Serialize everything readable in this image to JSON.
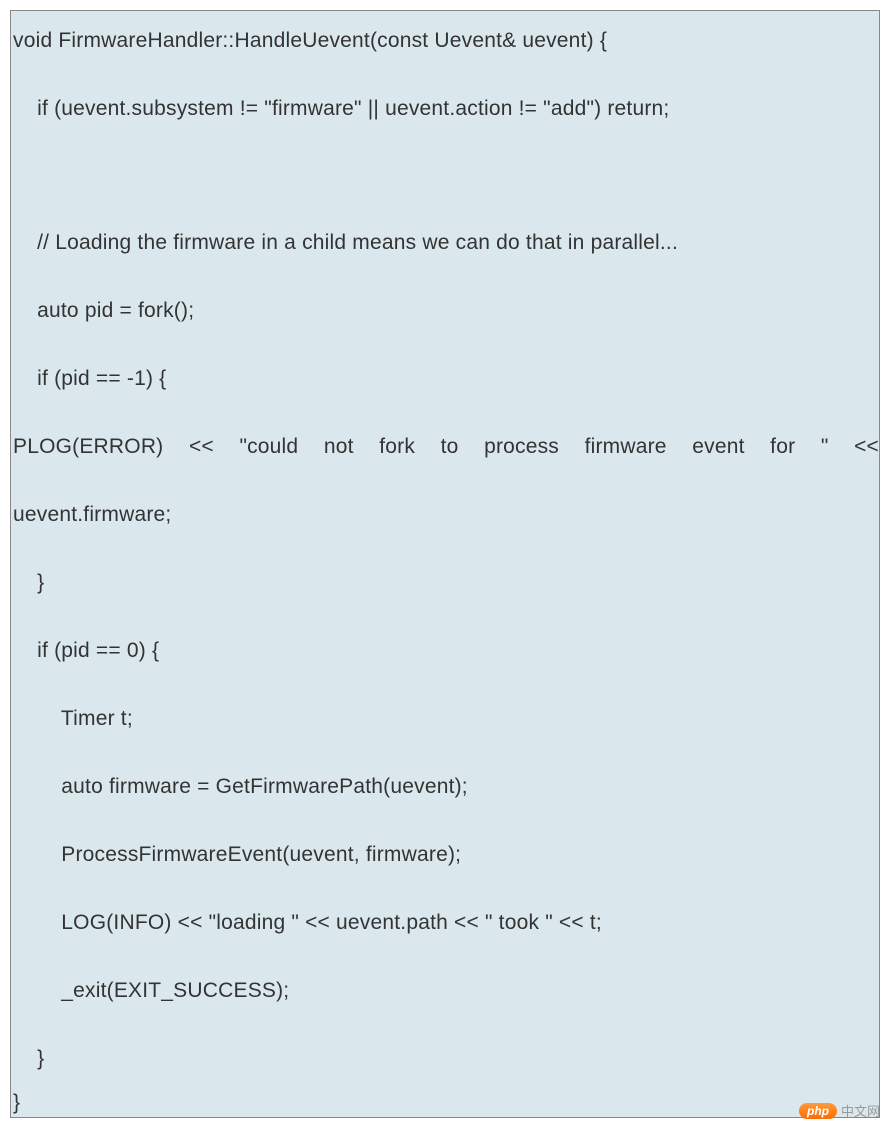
{
  "code": {
    "l0": "void FirmwareHandler::HandleUevent(const Uevent& uevent) {",
    "l1": "    if (uevent.subsystem != \"firmware\" || uevent.action != \"add\") return;",
    "l2": "    // Loading the firmware in a child means we can do that in parallel...",
    "l3": "    auto pid = fork();",
    "l4": "    if (pid == -1) {",
    "l5a": "        PLOG(ERROR) << \"could not fork to process firmware event for \" <<",
    "l5b": "uevent.firmware;",
    "l6": "    }",
    "l7": "    if (pid == 0) {",
    "l8": "        Timer t;",
    "l9": "        auto firmware = GetFirmwarePath(uevent);",
    "l10": "        ProcessFirmwareEvent(uevent, firmware);",
    "l11": "        LOG(INFO) << \"loading \" << uevent.path << \" took \" << t;",
    "l12": "        _exit(EXIT_SUCCESS);",
    "l13": "    }",
    "l14": "}"
  },
  "watermark": {
    "badge": "php",
    "text": "中文网"
  }
}
